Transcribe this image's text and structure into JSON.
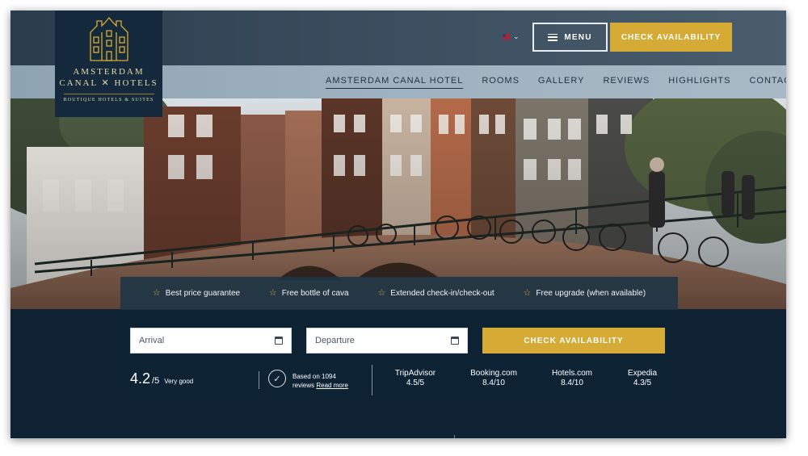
{
  "brand": {
    "line1": "AMSTERDAM",
    "line2": "CANAL ✕ HOTELS",
    "tagline": "BOUTIQUE HOTELS & SUITES",
    "colors": {
      "gold": "#d6ab35",
      "navy": "#0d2233"
    }
  },
  "header": {
    "language_icon": "uk-flag-icon",
    "menu_label": "MENU",
    "cta_label": "CHECK AVAILABILITY"
  },
  "nav": {
    "items": [
      {
        "label": "AMSTERDAM CANAL HOTEL",
        "active": true
      },
      {
        "label": "ROOMS"
      },
      {
        "label": "GALLERY"
      },
      {
        "label": "REVIEWS"
      },
      {
        "label": "HIGHLIGHTS"
      },
      {
        "label": "CONTACT"
      }
    ]
  },
  "perks": [
    {
      "label": "Best price guarantee"
    },
    {
      "label": "Free bottle of cava"
    },
    {
      "label": "Extended check-in/check-out"
    },
    {
      "label": "Free upgrade (when available)"
    }
  ],
  "booking": {
    "arrival_placeholder": "Arrival",
    "departure_placeholder": "Departure",
    "cta_label": "CHECK AVAILABILITY"
  },
  "rating": {
    "score": "4.2",
    "scale": "/5",
    "verdict": "Very good",
    "based_on": "Based on 1094",
    "reviews_word": "reviews",
    "read_more": "Read more"
  },
  "review_sites": [
    {
      "name": "TripAdvisor",
      "score": "4.5/5"
    },
    {
      "name": "Booking.com",
      "score": "8.4/10"
    },
    {
      "name": "Hotels.com",
      "score": "8.4/10"
    },
    {
      "name": "Expedia",
      "score": "4.3/5"
    }
  ]
}
